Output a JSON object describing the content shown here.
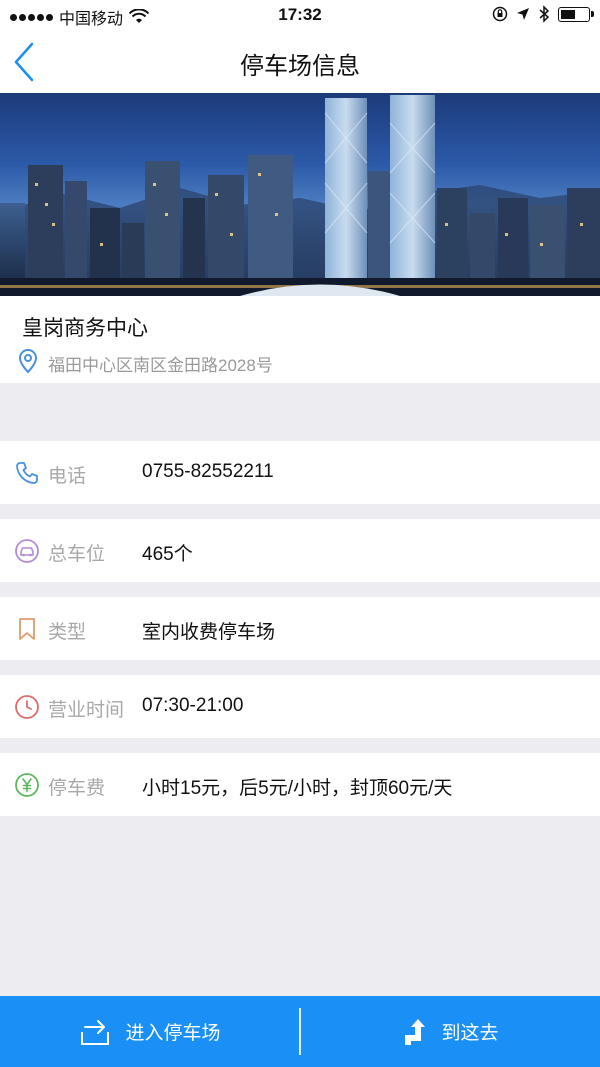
{
  "status_bar": {
    "carrier": "中国移动",
    "time": "17:32",
    "battery_level": 0.6
  },
  "nav": {
    "title": "停车场信息"
  },
  "place": {
    "name": "皇岗商务中心",
    "address": "福田中心区南区金田路2028号"
  },
  "info_rows": [
    {
      "icon": "phone-icon",
      "label": "电话",
      "value": "0755-82552211",
      "color": "#4a90e2"
    },
    {
      "icon": "car-icon",
      "label": "总车位",
      "value": "465个",
      "color": "#b58ad9"
    },
    {
      "icon": "bookmark-icon",
      "label": "类型",
      "value": "室内收费停车场",
      "color": "#e39a6b"
    },
    {
      "icon": "clock-icon",
      "label": "营业时间",
      "value": "07:30-21:00",
      "color": "#e06a6a"
    },
    {
      "icon": "yen-icon",
      "label": "停车费",
      "value": "小时15元，后5元/小时，封顶60元/天",
      "color": "#5cb85c"
    }
  ],
  "bottom": {
    "enter_label": "进入停车场",
    "go_label": "到这去"
  },
  "colors": {
    "accent": "#1a8ff5",
    "background": "#ececf1"
  }
}
